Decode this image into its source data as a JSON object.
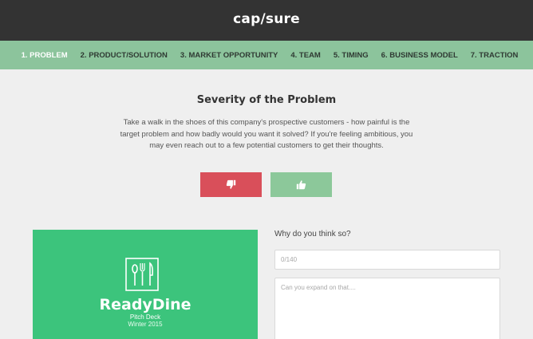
{
  "header": {
    "brand": "cap/sure"
  },
  "nav": {
    "items": [
      {
        "label": "1. PROBLEM",
        "active": true
      },
      {
        "label": "2. PRODUCT/SOLUTION",
        "active": false
      },
      {
        "label": "3. MARKET OPPORTUNITY",
        "active": false
      },
      {
        "label": "4. TEAM",
        "active": false
      },
      {
        "label": "5. TIMING",
        "active": false
      },
      {
        "label": "6. BUSINESS MODEL",
        "active": false
      },
      {
        "label": "7. TRACTION",
        "active": false
      }
    ]
  },
  "main": {
    "title": "Severity of the Problem",
    "description": "Take a walk in the shoes of this company's prospective customers - how painful is the target problem and how badly would you want it solved? If you're feeling ambitious, you may even reach out to a few potential customers to get their thoughts.",
    "thumbs_down_icon": "thumbs-down-icon",
    "thumbs_up_icon": "thumbs-up-icon"
  },
  "deck_card": {
    "icon": "utensils-icon",
    "title": "ReadyDine",
    "subtitle": "Pitch Deck",
    "date": "Winter 2015"
  },
  "feedback": {
    "question": "Why do you think so?",
    "short_placeholder": "0/140",
    "long_placeholder": "Can you expand on that...."
  },
  "colors": {
    "header_bg": "#333333",
    "nav_bg": "#8cc49c",
    "thumbs_down_bg": "#d94f5a",
    "thumbs_up_bg": "#8cc89a",
    "card_bg": "#3cc47c"
  }
}
